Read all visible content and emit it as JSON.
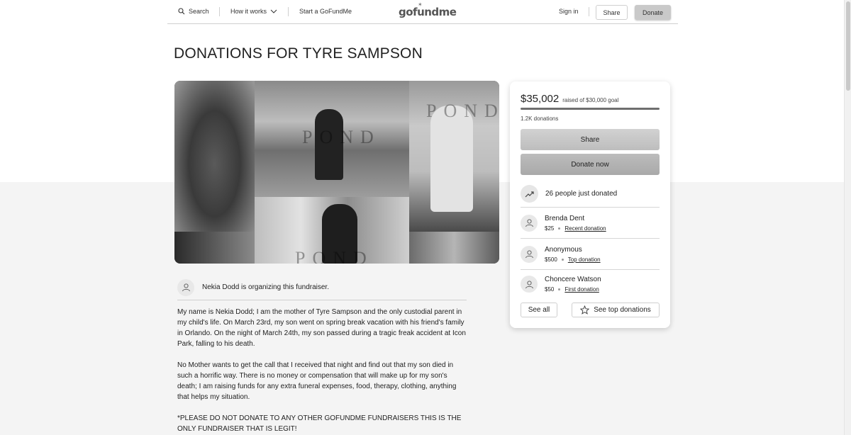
{
  "header": {
    "search_label": "Search",
    "how_it_works_label": "How it works",
    "start_label": "Start a GoFundMe",
    "logo_text": "gofundme",
    "sign_in_label": "Sign in",
    "share_label": "Share",
    "donate_label": "Donate"
  },
  "campaign": {
    "title": "DONATIONS FOR TYRE SAMPSON",
    "collage_watermark": "POND",
    "organizer_text": "Nekia Dodd is organizing this fundraiser.",
    "story": [
      "My name is Nekia Dodd; I am the mother of Tyre Sampson and the only custodial parent in my child's life. On March 23rd, my son went on spring break vacation with his friend's family in Orlando. On the night of March 24th, my son passed during a tragic freak accident at Icon Park, falling to his death.",
      "No Mother wants to get the call that I received that night and find out that my son died in such a horrific way. There is no money or compensation that will make up for my son's death; I am raising funds for any extra funeral expenses, food, therapy, clothing, anything that helps my situation.",
      "*PLEASE DO NOT DONATE TO ANY OTHER GOFUNDME FUNDRAISERS THIS IS THE ONLY FUNDRAISER THAT IS LEGIT!"
    ]
  },
  "card": {
    "raised_amount": "$35,002",
    "raised_goal_text": "raised of $30,000 goal",
    "progress_fraction": 1.0,
    "donation_count": "1.2K donations",
    "share_label": "Share",
    "donate_now_label": "Donate now",
    "recent_activity": "26 people just donated",
    "donations": [
      {
        "name": "Brenda Dent",
        "amount": "$25",
        "tag": "Recent donation"
      },
      {
        "name": "Anonymous",
        "amount": "$500",
        "tag": "Top donation"
      },
      {
        "name": "Choncere Watson",
        "amount": "$50",
        "tag": "First donation"
      }
    ],
    "see_all_label": "See all",
    "see_top_label": "See top donations"
  }
}
